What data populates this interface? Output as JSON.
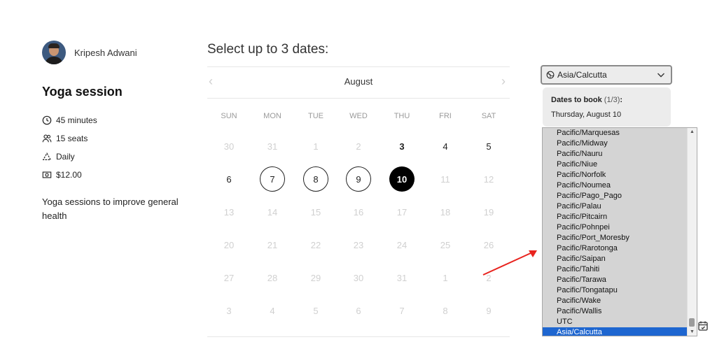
{
  "host": {
    "name": "Kripesh Adwani",
    "avatar": "avatar"
  },
  "event": {
    "title": "Yoga session",
    "details": [
      {
        "icon": "clock-icon",
        "text": "45 minutes"
      },
      {
        "icon": "people-icon",
        "text": "15 seats"
      },
      {
        "icon": "recurrence-icon",
        "text": "Daily"
      },
      {
        "icon": "money-icon",
        "text": "$12.00"
      }
    ],
    "description": "Yoga sessions to improve general health"
  },
  "calendar": {
    "heading": "Select up to 3 dates:",
    "month": "August",
    "prev": "‹",
    "next": "›",
    "weekdays": [
      "SUN",
      "MON",
      "TUE",
      "WED",
      "THU",
      "FRI",
      "SAT"
    ],
    "weeks": [
      [
        {
          "d": "30",
          "s": "disabled"
        },
        {
          "d": "31",
          "s": "disabled"
        },
        {
          "d": "1",
          "s": "disabled"
        },
        {
          "d": "2",
          "s": "disabled"
        },
        {
          "d": "3",
          "s": "bold"
        },
        {
          "d": "4",
          "s": "available"
        },
        {
          "d": "5",
          "s": "available"
        }
      ],
      [
        {
          "d": "6",
          "s": "available"
        },
        {
          "d": "7",
          "s": "ringed"
        },
        {
          "d": "8",
          "s": "ringed"
        },
        {
          "d": "9",
          "s": "ringed"
        },
        {
          "d": "10",
          "s": "selected"
        },
        {
          "d": "11",
          "s": "disabled"
        },
        {
          "d": "12",
          "s": "disabled"
        }
      ],
      [
        {
          "d": "13",
          "s": "disabled"
        },
        {
          "d": "14",
          "s": "disabled"
        },
        {
          "d": "15",
          "s": "disabled"
        },
        {
          "d": "16",
          "s": "disabled"
        },
        {
          "d": "17",
          "s": "disabled"
        },
        {
          "d": "18",
          "s": "disabled"
        },
        {
          "d": "19",
          "s": "disabled"
        }
      ],
      [
        {
          "d": "20",
          "s": "disabled"
        },
        {
          "d": "21",
          "s": "disabled"
        },
        {
          "d": "22",
          "s": "disabled"
        },
        {
          "d": "23",
          "s": "disabled"
        },
        {
          "d": "24",
          "s": "disabled"
        },
        {
          "d": "25",
          "s": "disabled"
        },
        {
          "d": "26",
          "s": "disabled"
        }
      ],
      [
        {
          "d": "27",
          "s": "disabled"
        },
        {
          "d": "28",
          "s": "disabled"
        },
        {
          "d": "29",
          "s": "disabled"
        },
        {
          "d": "30",
          "s": "disabled"
        },
        {
          "d": "31",
          "s": "disabled"
        },
        {
          "d": "1",
          "s": "disabled"
        },
        {
          "d": "2",
          "s": "disabled"
        }
      ],
      [
        {
          "d": "3",
          "s": "disabled"
        },
        {
          "d": "4",
          "s": "disabled"
        },
        {
          "d": "5",
          "s": "disabled"
        },
        {
          "d": "6",
          "s": "disabled"
        },
        {
          "d": "7",
          "s": "disabled"
        },
        {
          "d": "8",
          "s": "disabled"
        },
        {
          "d": "9",
          "s": "disabled"
        }
      ]
    ]
  },
  "timezone": {
    "selected": "Asia/Calcutta",
    "icon": "globe-icon",
    "dates_label": "Dates to book",
    "dates_count": "(1/3)",
    "dates_colon": ":",
    "booked_date": "Thursday, August 10",
    "options": [
      "Pacific/Marquesas",
      "Pacific/Midway",
      "Pacific/Nauru",
      "Pacific/Niue",
      "Pacific/Norfolk",
      "Pacific/Noumea",
      "Pacific/Pago_Pago",
      "Pacific/Palau",
      "Pacific/Pitcairn",
      "Pacific/Pohnpei",
      "Pacific/Port_Moresby",
      "Pacific/Rarotonga",
      "Pacific/Saipan",
      "Pacific/Tahiti",
      "Pacific/Tarawa",
      "Pacific/Tongatapu",
      "Pacific/Wake",
      "Pacific/Wallis",
      "UTC",
      "Asia/Calcutta"
    ],
    "highlighted_option": "Asia/Calcutta"
  },
  "colors": {
    "annotation_arrow": "#e8231e",
    "highlight": "#1e66d0",
    "selected_day": "#000000"
  }
}
